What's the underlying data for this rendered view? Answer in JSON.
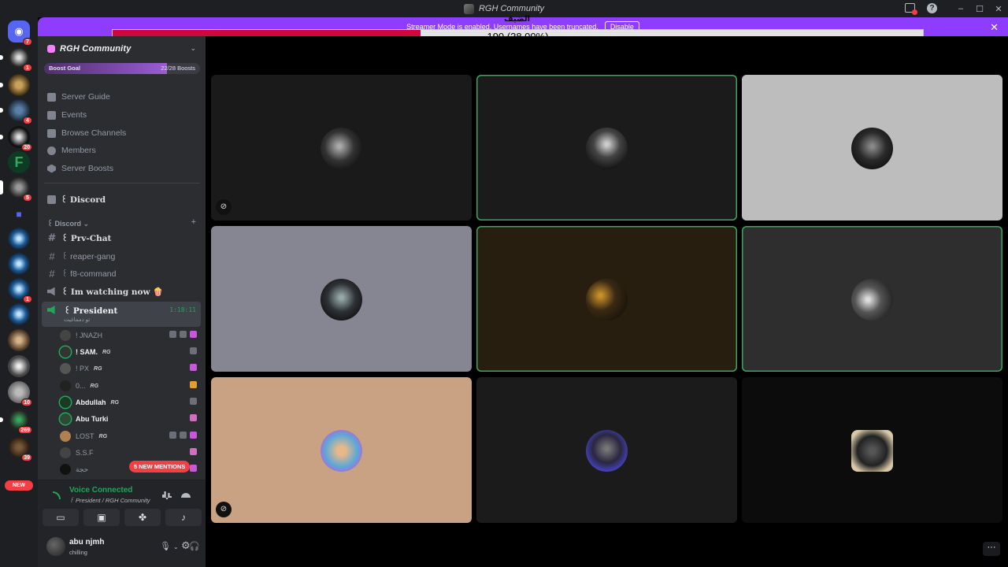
{
  "window": {
    "title": "RGH Community"
  },
  "banner": {
    "text": "Streamer Mode is enabled. Usernames have been truncated.",
    "disable_label": "Disable"
  },
  "progress": {
    "value": 190,
    "percent": 38.0,
    "label": "190 (38.00%)",
    "fill_color": "#d1063e"
  },
  "overlay_text": "الضيف",
  "rail": {
    "badges": [
      "7",
      "1",
      "",
      "4",
      "20",
      "",
      "5",
      "",
      "",
      "",
      "1",
      "",
      "",
      "10",
      "269",
      "39"
    ],
    "new_label": "NEW"
  },
  "server": {
    "name": "RGH Community",
    "boost_label": "Boost Goal",
    "boost_count": "22/28 Boosts",
    "boost_fraction": 0.786
  },
  "nav": [
    {
      "label": "Server Guide",
      "icon": "book-icon"
    },
    {
      "label": "Events",
      "icon": "calendar-icon"
    },
    {
      "label": "Browse Channels",
      "icon": "list-icon"
    },
    {
      "label": "Members",
      "icon": "members-icon"
    },
    {
      "label": "Server Boosts",
      "icon": "boost-icon"
    }
  ],
  "discord_channel": "꒰ Discord",
  "category": "꒰ Discord",
  "channels": [
    {
      "label": "꒰ Prv-Chat",
      "type": "text"
    },
    {
      "label": "꒰ reaper-gang",
      "type": "text"
    },
    {
      "label": "꒰ f8-command",
      "type": "text"
    },
    {
      "label": "꒰ Im watching now 🍿",
      "type": "voice"
    }
  ],
  "voice": {
    "name": "꒰ President",
    "time": "1:18:11",
    "status": "تو دمماغيت"
  },
  "members": [
    {
      "name": "! JNAZH",
      "tag": "",
      "highlight": false
    },
    {
      "name": "! SAM.",
      "tag": "RG",
      "highlight": true
    },
    {
      "name": "! PX",
      "tag": "RG",
      "highlight": false
    },
    {
      "name": "0...",
      "tag": "RG",
      "highlight": false
    },
    {
      "name": "Abdullah",
      "tag": "RG",
      "highlight": true
    },
    {
      "name": "Abu Turki",
      "tag": "",
      "highlight": true
    },
    {
      "name": "LOST",
      "tag": "RG",
      "highlight": false
    },
    {
      "name": "S.S.F",
      "tag": "",
      "highlight": false
    },
    {
      "name": "حجة",
      "tag": "",
      "highlight": false
    }
  ],
  "mentions_label": "5 NEW MENTIONS",
  "voice_panel": {
    "title": "Voice Connected",
    "subtitle": "꒰ President / RGH Community"
  },
  "user": {
    "name": "abu njmh",
    "status": "chilling"
  },
  "colors": {
    "accent": "#8e3dff",
    "speaking": "#3ba55d",
    "danger": "#f23f43"
  }
}
